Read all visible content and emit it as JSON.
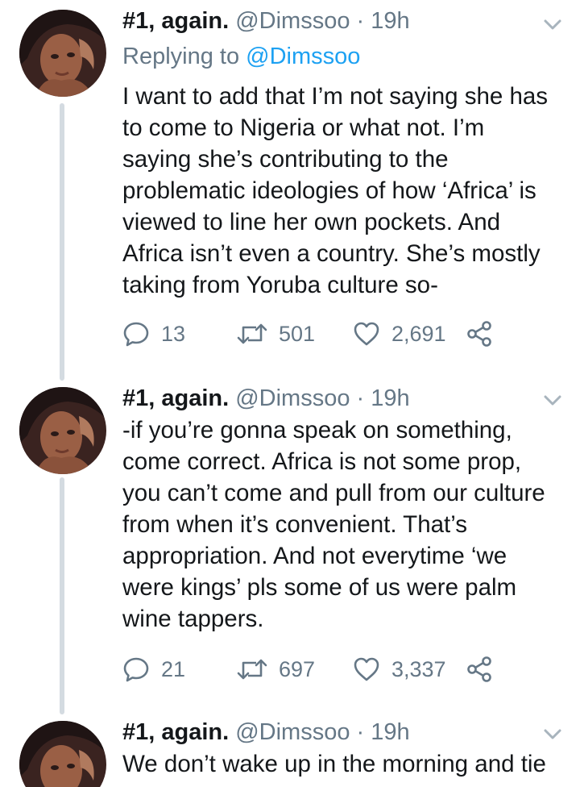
{
  "tweets": [
    {
      "name": "#1, again.",
      "handle": "@Dimssoo",
      "separator": "·",
      "time": "19h",
      "replying_prefix": "Replying to",
      "replying_to": "@Dimssoo",
      "lines": [
        "I want to add that I’m not saying she has",
        "to come to Nigeria or what not. I’m",
        "saying she’s contributing to the",
        "problematic ideologies of how ‘Africa’ is",
        "viewed to line her own pockets. And",
        "Africa isn’t even a country. She’s mostly",
        "taking from Yoruba culture so-"
      ],
      "replies": "13",
      "retweets": "501",
      "likes": "2,691"
    },
    {
      "name": "#1, again.",
      "handle": "@Dimssoo",
      "separator": "·",
      "time": "19h",
      "lines": [
        "-if you’re gonna speak on something,",
        "come correct. Africa is not some prop,",
        "you can’t come and pull from our culture",
        "from when it’s convenient. That’s",
        "appropriation. And not everytime ‘we",
        "were kings’ pls some of us were palm",
        "wine tappers."
      ],
      "replies": "21",
      "retweets": "697",
      "likes": "3,337"
    },
    {
      "name": "#1, again.",
      "handle": "@Dimssoo",
      "separator": "·",
      "time": "19h",
      "lines": [
        "We don’t wake up in the morning and tie"
      ]
    }
  ],
  "icons": {
    "reply": "reply-icon",
    "retweet": "retweet-icon",
    "like": "heart-icon",
    "share": "share-icon",
    "more": "chevron-down-icon"
  },
  "colors": {
    "text": "#14171a",
    "secondary": "#657786",
    "link": "#1da1f2",
    "thread_line": "#d4dbe1"
  }
}
